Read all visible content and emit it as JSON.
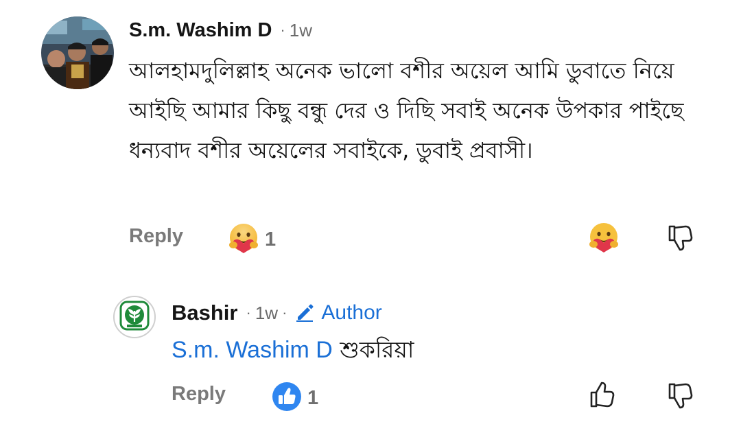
{
  "comment": {
    "author": "S.m. Washim D",
    "separator": "·",
    "time": "1w",
    "text": "আলহামদুলিল্লাহ অনেক ভালো বশীর অয়েল আমি ডুবাতে নিয়ে আইছি আমার কিছু বন্ধু দের ও দিছি সবাই অনেক উপকার পাইছে ধন্যবাদ বশীর অয়েলের সবাইকে, ডুবাই প্রবাসী।",
    "reply_label": "Reply",
    "reaction": {
      "icon": "care-emoji-icon",
      "count": "1"
    },
    "actions": [
      "care-emoji-icon",
      "dislike-icon"
    ]
  },
  "reply": {
    "author": "Bashir",
    "separator": "·",
    "time": "1w",
    "author_badge": "Author",
    "mention": "S.m. Washim D",
    "text": "শুকরিয়া",
    "reply_label": "Reply",
    "reaction": {
      "icon": "like-icon",
      "count": "1"
    },
    "actions": [
      "like-icon",
      "dislike-icon"
    ]
  },
  "colors": {
    "link_blue": "#1a6fd6",
    "muted_text": "#6a6a6a",
    "like_blue": "#2f86f0",
    "logo_green": "#1f8a3a"
  }
}
